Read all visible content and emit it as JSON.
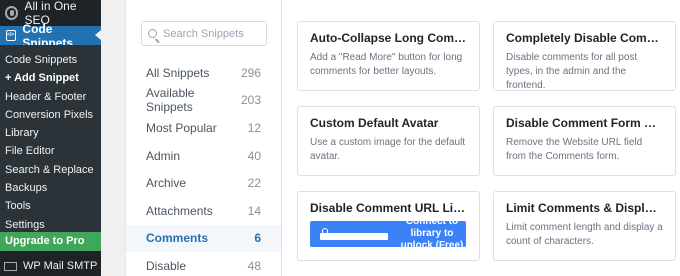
{
  "sidebar": {
    "top_item": "All in One SEO",
    "current_menu": "Code Snippets",
    "submenu": [
      "Code Snippets",
      "+ Add Snippet",
      "Header & Footer",
      "Conversion Pixels",
      "Library",
      "File Editor",
      "Search & Replace",
      "Backups",
      "Tools",
      "Settings"
    ],
    "upgrade": "Upgrade to Pro",
    "bottom_item": "WP Mail SMTP"
  },
  "search": {
    "placeholder": "Search Snippets"
  },
  "categories": [
    {
      "label": "All Snippets",
      "count": "296"
    },
    {
      "label": "Available Snippets",
      "count": "203"
    },
    {
      "label": "Most Popular",
      "count": "12"
    },
    {
      "label": "Admin",
      "count": "40"
    },
    {
      "label": "Archive",
      "count": "22"
    },
    {
      "label": "Attachments",
      "count": "14"
    },
    {
      "label": "Comments",
      "count": "6"
    },
    {
      "label": "Disable",
      "count": "48"
    }
  ],
  "snippets": [
    {
      "title": "Auto-Collapse Long Comments",
      "desc": "Add a \"Read More\" button for long comments for better layouts."
    },
    {
      "title": "Completely Disable Comments",
      "desc": "Disable comments for all post types, in the admin and the frontend."
    },
    {
      "title": "Custom Default Avatar",
      "desc": "Use a custom image for the default avatar."
    },
    {
      "title": "Disable Comment Form Website URL",
      "desc": "Remove the Website URL field from the Comments form."
    },
    {
      "title": "Disable Comment URL Linking",
      "button": "Connect to library to unlock (Free)"
    },
    {
      "title": "Limit Comments & Display Character Count",
      "desc": "Limit comment length and display a count of characters."
    }
  ]
}
